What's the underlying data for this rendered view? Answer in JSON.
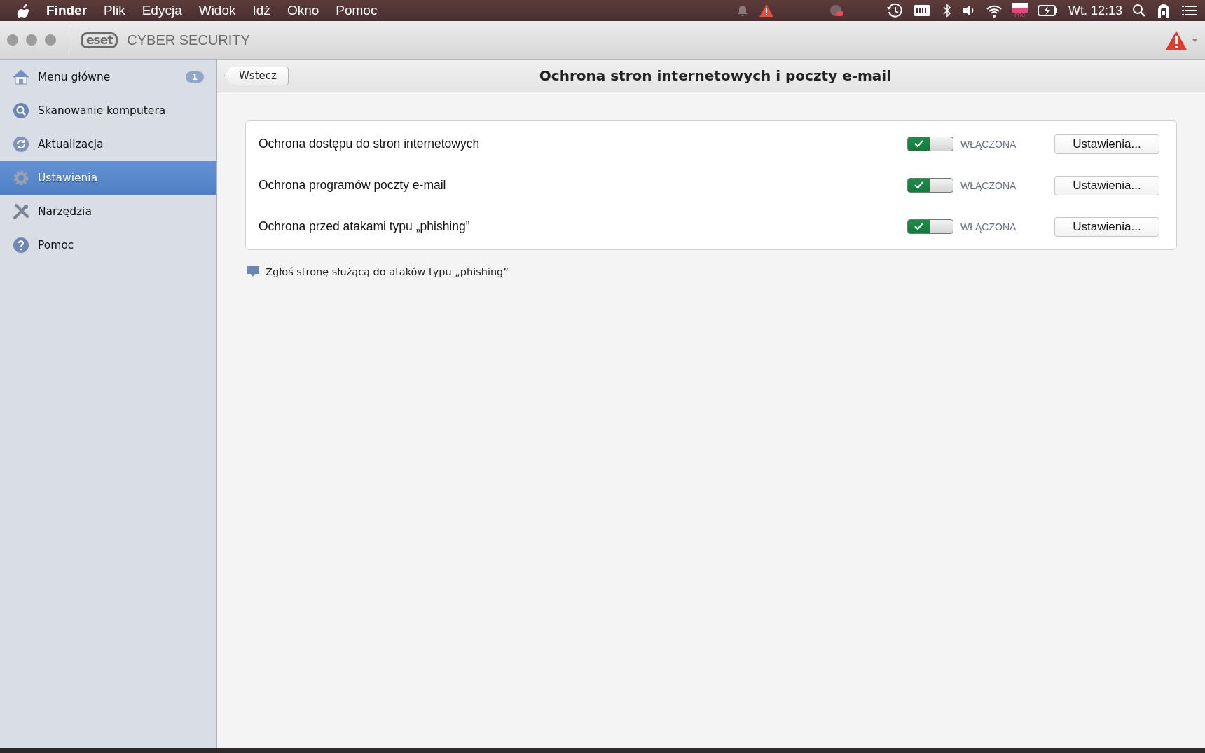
{
  "menubar": {
    "app_name": "Finder",
    "menus": [
      "Plik",
      "Edycja",
      "Widok",
      "Idź",
      "Okno",
      "Pomoc"
    ],
    "flag_badge": "PRO",
    "clock": "Wt. 12:13"
  },
  "window": {
    "logo": "eset",
    "title": "CYBER SECURITY"
  },
  "sidebar": {
    "items": [
      {
        "kind": "home",
        "label": "Menu główne",
        "badge": "1",
        "selected": false
      },
      {
        "kind": "scan",
        "label": "Skanowanie komputera",
        "selected": false
      },
      {
        "kind": "update",
        "label": "Aktualizacja",
        "selected": false
      },
      {
        "kind": "settings",
        "label": "Ustawienia",
        "selected": true
      },
      {
        "kind": "tools",
        "label": "Narzędzia",
        "selected": false
      },
      {
        "kind": "help",
        "label": "Pomoc",
        "selected": false
      }
    ]
  },
  "page": {
    "back_button": "Wstecz",
    "title": "Ochrona stron internetowych i poczty e-mail",
    "settings": [
      {
        "label": "Ochrona dostępu do stron internetowych",
        "on": true,
        "status": "WŁĄCZONA",
        "button": "Ustawienia..."
      },
      {
        "label": "Ochrona programów poczty e-mail",
        "on": true,
        "status": "WŁĄCZONA",
        "button": "Ustawienia..."
      },
      {
        "label": "Ochrona przed atakami typu „phishing”",
        "on": true,
        "status": "WŁĄCZONA",
        "button": "Ustawienia..."
      }
    ],
    "report_link": "Zgłoś stronę służącą do ataków typu „phishing”"
  }
}
